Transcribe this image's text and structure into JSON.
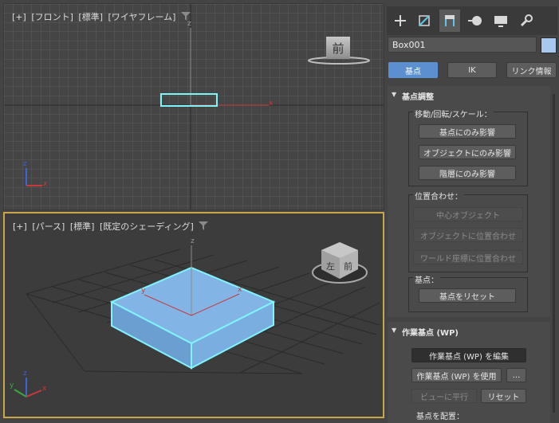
{
  "viewports": {
    "front": {
      "label_parts": [
        "[+]",
        "[フロント]",
        "[標準]",
        "[ワイヤフレーム]"
      ],
      "viewcube_face": "前",
      "axis_z": "z",
      "axis_x": "x"
    },
    "perspective": {
      "label_parts": [
        "[+]",
        "[パース]",
        "[標準]",
        "[既定のシェーディング]"
      ],
      "viewcube_faces": [
        "左",
        "前"
      ],
      "axis_z": "z",
      "axis_y": "y",
      "axis_x": "x"
    },
    "filter_icon": "funnel-icon"
  },
  "command_panel": {
    "tabs": [
      "create-plus-icon",
      "modify-icon",
      "hierarchy-icon",
      "motion-icon",
      "display-icon",
      "utilities-wrench-icon"
    ],
    "active_tab": 2,
    "object_name": "Box001",
    "object_color": "#a9c8f0",
    "mode_buttons": [
      "基点",
      "IK",
      "リンク情報"
    ],
    "active_mode": 0,
    "rollout_pivot": {
      "title": "基点調整",
      "move_group_label": "移動/回転/スケール：",
      "affect_pivot_only": "基点にのみ影響",
      "affect_object_only": "オブジェクトにのみ影響",
      "affect_hierarchy_only": "階層にのみ影響",
      "align_group_label": "位置合わせ：",
      "center_to_object": "中心オブジェクト",
      "align_to_object": "オブジェクトに位置合わせ",
      "align_to_world": "ワールド座標に位置合わせ",
      "pivot_group_label": "基点：",
      "reset_pivot": "基点をリセット"
    },
    "rollout_wp": {
      "title": "作業基点 (WP)",
      "edit_wp": "作業基点 (WP) を編集",
      "use_wp": "作業基点 (WP) を使用",
      "more": "...",
      "align_to_view": "ビューに平行",
      "reset": "リセット",
      "place_pivot_label": "基点を配置："
    }
  },
  "colors": {
    "selection_cyan": "#7ff4ff",
    "box_face": "#7aaee0",
    "active_viewport_border": "#c9a64a"
  }
}
